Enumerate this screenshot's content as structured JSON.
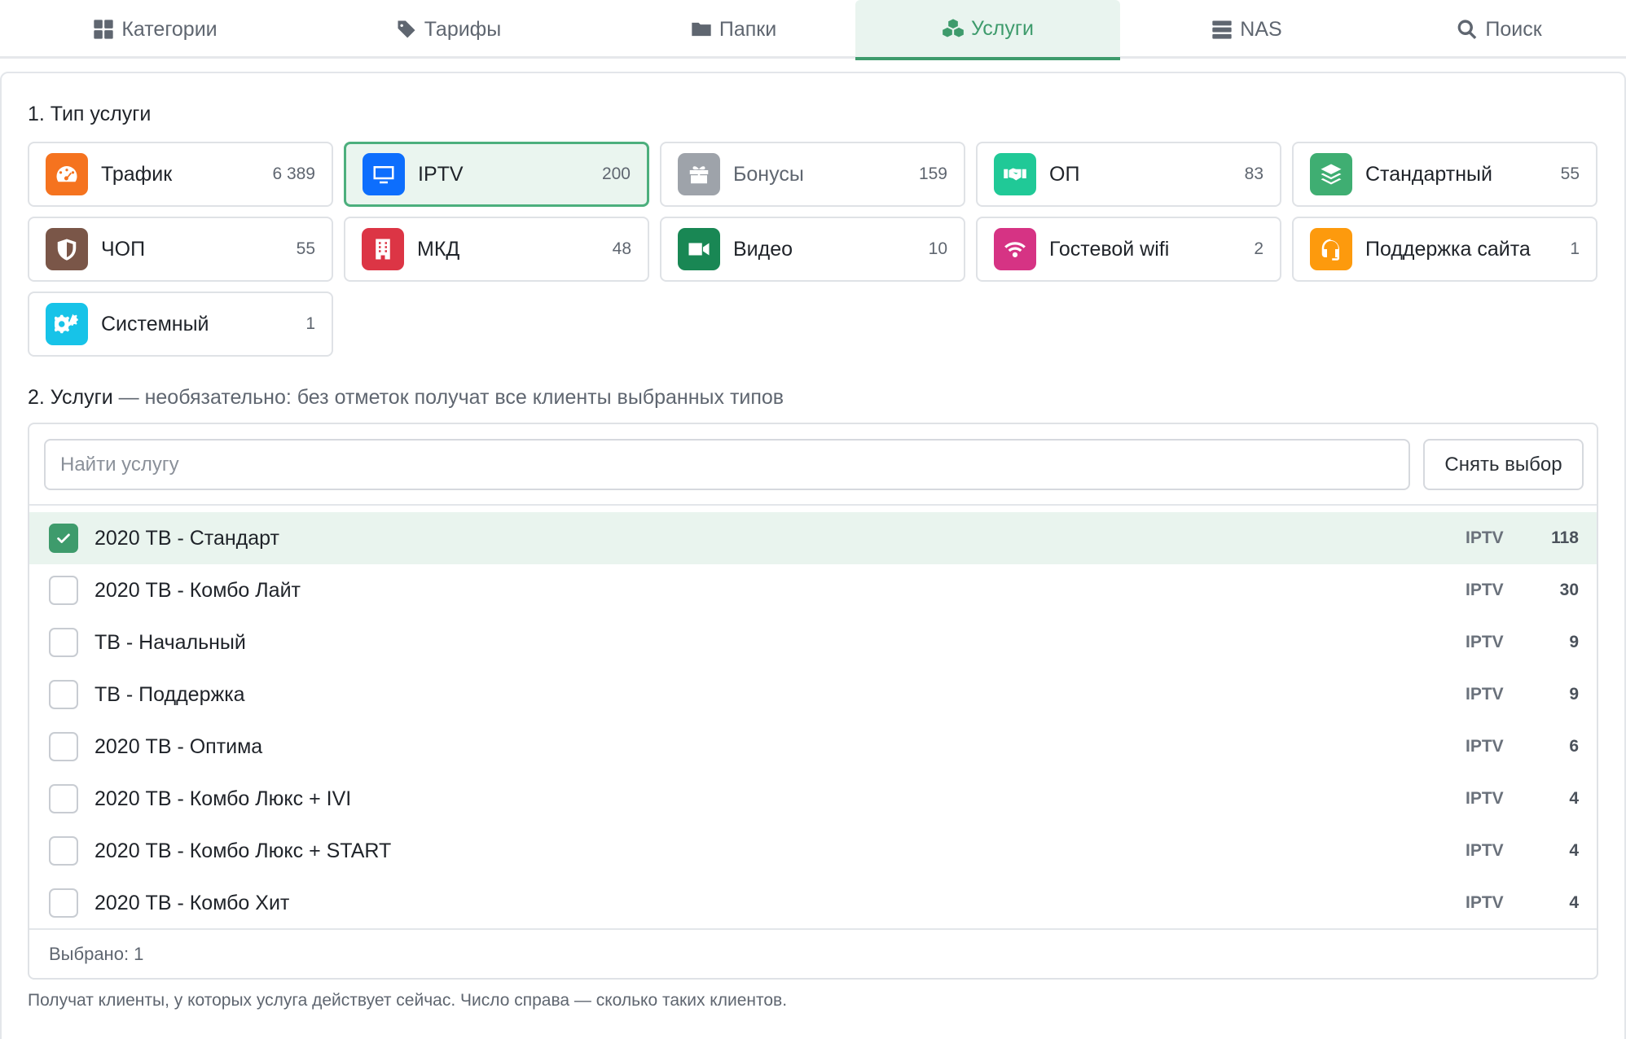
{
  "tabs": [
    {
      "label": "Категории",
      "icon": "grid-icon"
    },
    {
      "label": "Тарифы",
      "icon": "tags-icon"
    },
    {
      "label": "Папки",
      "icon": "folder-icon"
    },
    {
      "label": "Услуги",
      "icon": "cubes-icon",
      "active": true
    },
    {
      "label": "NAS",
      "icon": "server-icon"
    },
    {
      "label": "Поиск",
      "icon": "search-icon"
    }
  ],
  "section1": {
    "title": "1. Тип услуги"
  },
  "types": [
    {
      "name": "Трафик",
      "count": "6 389",
      "color": "#f5731f",
      "icon": "speedometer-icon"
    },
    {
      "name": "IPTV",
      "count": "200",
      "color": "#0d6efd",
      "icon": "monitor-icon",
      "selected": true
    },
    {
      "name": "Бонусы",
      "count": "159",
      "color": "#9ea3aa",
      "icon": "gift-icon",
      "dim": true
    },
    {
      "name": "ОП",
      "count": "83",
      "color": "#20c997",
      "icon": "handshake-icon"
    },
    {
      "name": "Стандартный",
      "count": "55",
      "color": "#3fae72",
      "icon": "layers-icon"
    },
    {
      "name": "ЧОП",
      "count": "55",
      "color": "#7a5648",
      "icon": "shield-icon"
    },
    {
      "name": "МКД",
      "count": "48",
      "color": "#dc3545",
      "icon": "building-icon"
    },
    {
      "name": "Видео",
      "count": "10",
      "color": "#198754",
      "icon": "video-icon"
    },
    {
      "name": "Гостевой wifi",
      "count": "2",
      "color": "#d63384",
      "icon": "wifi-icon"
    },
    {
      "name": "Поддержка сайта",
      "count": "1",
      "color": "#fd9a0d",
      "icon": "headset-icon"
    },
    {
      "name": "Системный",
      "count": "1",
      "color": "#17c3e8",
      "icon": "gears-icon"
    }
  ],
  "section2": {
    "title": "2. Услуги",
    "note": " — необязательно: без отметок получат все клиенты выбранных типов"
  },
  "search": {
    "placeholder": "Найти услугу",
    "value": ""
  },
  "clear_label": "Снять выбор",
  "services": [
    {
      "name": "2020 ТВ - Стандарт",
      "type": "IPTV",
      "count": "118",
      "checked": true
    },
    {
      "name": "2020 ТВ - Комбо Лайт",
      "type": "IPTV",
      "count": "30",
      "checked": false
    },
    {
      "name": "ТВ - Начальный",
      "type": "IPTV",
      "count": "9",
      "checked": false
    },
    {
      "name": "ТВ - Поддержка",
      "type": "IPTV",
      "count": "9",
      "checked": false
    },
    {
      "name": "2020 ТВ - Оптима",
      "type": "IPTV",
      "count": "6",
      "checked": false
    },
    {
      "name": "2020 ТВ - Комбо Люкс + IVI",
      "type": "IPTV",
      "count": "4",
      "checked": false
    },
    {
      "name": "2020 ТВ - Комбо Люкс + START",
      "type": "IPTV",
      "count": "4",
      "checked": false
    },
    {
      "name": "2020 ТВ - Комбо Хит",
      "type": "IPTV",
      "count": "4",
      "checked": false
    }
  ],
  "selected_label": "Выбрано: 1",
  "hint": "Получат клиенты, у которых услуга действует сейчас. Число справа — сколько таких клиентов.",
  "colors": {
    "accent": "#3e9b6c",
    "selected_bg": "#eaf5ef"
  }
}
